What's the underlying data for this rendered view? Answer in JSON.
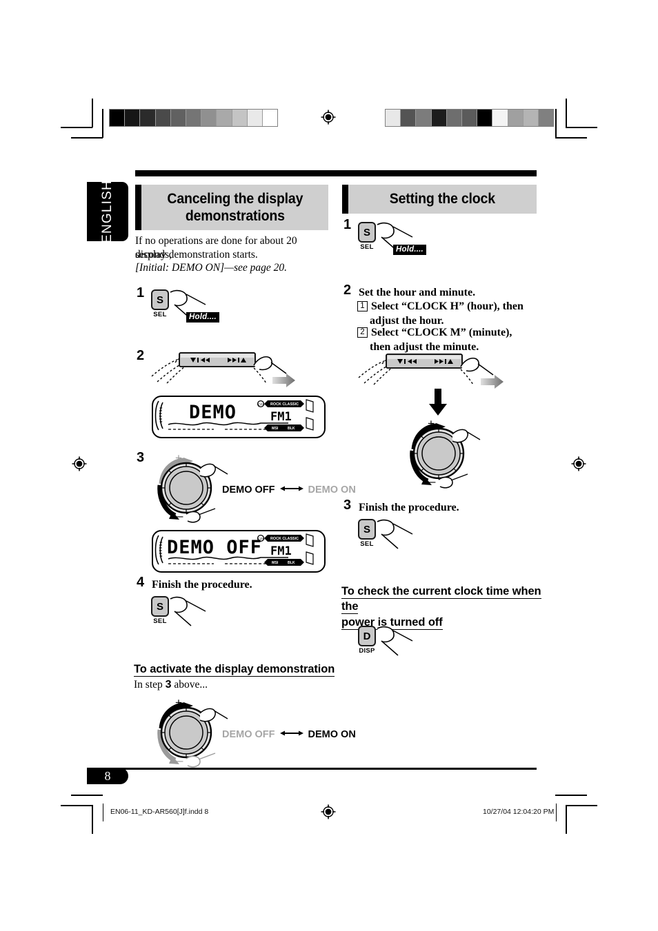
{
  "language_tab": "ENGLISH",
  "page_number": "8",
  "left_column": {
    "heading_line1": "Canceling the display",
    "heading_line2": "demonstrations",
    "intro_line1": "If no operations are done for about 20 seconds,",
    "intro_line2": "display demonstration starts.",
    "intro_italic": "[Initial: DEMO ON]—see page 20.",
    "steps": [
      {
        "number": "1",
        "hold_label": "Hold....",
        "button_cap": "S",
        "button_sub": "SEL"
      },
      {
        "number": "2"
      },
      {
        "number": "3"
      },
      {
        "number": "4",
        "text": "Finish the procedure.",
        "button_cap": "S",
        "button_sub": "SEL"
      }
    ],
    "lcd_demo": {
      "main": "DEMO",
      "band": "FM 1",
      "top_left_icon": "CPS",
      "top_label": "ROCK CLASSIC",
      "bottom_left": "MSI",
      "bottom_right": "BLK"
    },
    "lcd_demo_off": {
      "main": "DEMO OFF",
      "band": "FM 1",
      "top_left_icon": "CPS",
      "top_label": "ROCK CLASSIC",
      "bottom_left": "MSI",
      "bottom_right": "BLK"
    },
    "toggle_step3": {
      "left": "DEMO OFF",
      "right": "DEMO ON",
      "active": "left"
    },
    "subsection": {
      "heading": "To activate the display demonstration",
      "lead_prefix": "In step ",
      "lead_number": "3",
      "lead_suffix": " above...",
      "toggle": {
        "left": "DEMO OFF",
        "right": "DEMO ON",
        "active": "right"
      }
    }
  },
  "right_column": {
    "heading": "Setting the clock",
    "steps": [
      {
        "number": "1",
        "hold_label": "Hold....",
        "button_cap": "S",
        "button_sub": "SEL"
      },
      {
        "number": "2",
        "text": "Set the hour and minute.",
        "substeps": [
          {
            "marker": "1",
            "line1": "Select “CLOCK H” (hour), then",
            "line2": "adjust the hour."
          },
          {
            "marker": "2",
            "line1": "Select “CLOCK M” (minute),",
            "line2": "then adjust the minute."
          }
        ]
      },
      {
        "number": "3",
        "text": "Finish the procedure.",
        "button_cap": "S",
        "button_sub": "SEL"
      }
    ],
    "subsection": {
      "heading_line1": "To check the current clock time when the",
      "heading_line2": "power is turned off",
      "button_cap": "D",
      "button_sub": "DISP"
    }
  },
  "panel_buttons": {
    "left_glyph": "∨|◀◀",
    "right_glyph": "▶▶|∧"
  },
  "footer": {
    "file": "EN06-11_KD-AR560[J]f.indd   8",
    "timestamp": "10/27/04   12:04:20 PM"
  },
  "calibration": {
    "left_ramp": [
      "#000000",
      "#161616",
      "#2b2b2b",
      "#4a4a4a",
      "#616161",
      "#757575",
      "#909090",
      "#a9a9a9",
      "#c4c4c4",
      "#e9e9e9",
      "#ffffff"
    ],
    "right_ramp": [
      "#e8e8e8",
      "#545454",
      "#7c7c7c",
      "#1d1d1d",
      "#6e6e6e",
      "#5b5b5b",
      "#000000",
      "#f4f4f4",
      "#a0a0a0",
      "#b4b4b4",
      "#808080"
    ]
  },
  "colors": {
    "header_bg": "#cfcfcf",
    "key_face": "#c9c9c9",
    "muted_text": "#a6a6a6",
    "ink": "#000000"
  }
}
